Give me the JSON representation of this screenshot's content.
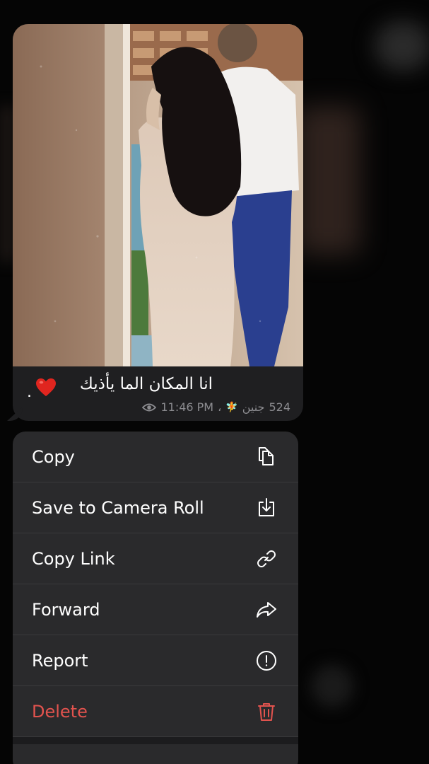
{
  "message": {
    "caption": "انا المكان الما يأذيك",
    "caption_suffix": ".",
    "views": "524",
    "author": "جنين",
    "author_suffix": "،",
    "time": "11:46 PM"
  },
  "menu": {
    "items": [
      {
        "label": "Copy",
        "icon": "copy-icon"
      },
      {
        "label": "Save to Camera Roll",
        "icon": "save-download-icon"
      },
      {
        "label": "Copy Link",
        "icon": "link-icon"
      },
      {
        "label": "Forward",
        "icon": "forward-arrow-icon"
      },
      {
        "label": "Report",
        "icon": "report-exclamation-icon"
      },
      {
        "label": "Delete",
        "icon": "trash-icon",
        "color": "#e2534e"
      }
    ]
  },
  "colors": {
    "background": "#050505",
    "bubble": "#1f1f21",
    "menu": "#2a2a2c",
    "danger": "#e2534e",
    "meta": "#8c8c90"
  }
}
